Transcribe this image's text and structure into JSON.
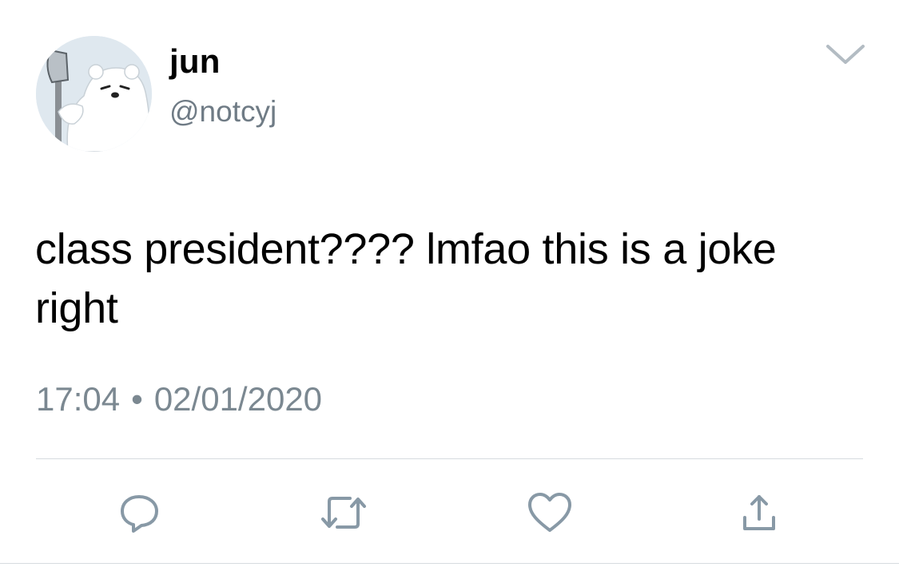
{
  "author": {
    "display_name": "jun",
    "handle": "@notcyj",
    "avatar_icon": "polar-bear-avatar-icon"
  },
  "tweet": {
    "text": "class president???? lmfao this is a joke right",
    "time": "17:04",
    "separator": "•",
    "date": "02/01/2020"
  },
  "actions": {
    "reply_icon": "reply-bubble-icon",
    "retweet_icon": "retweet-icon",
    "like_icon": "heart-icon",
    "share_icon": "share-upload-icon"
  },
  "colors": {
    "secondary_text": "#7b8891",
    "icon_gray": "#8899a6",
    "divider": "#d6dbdf"
  }
}
